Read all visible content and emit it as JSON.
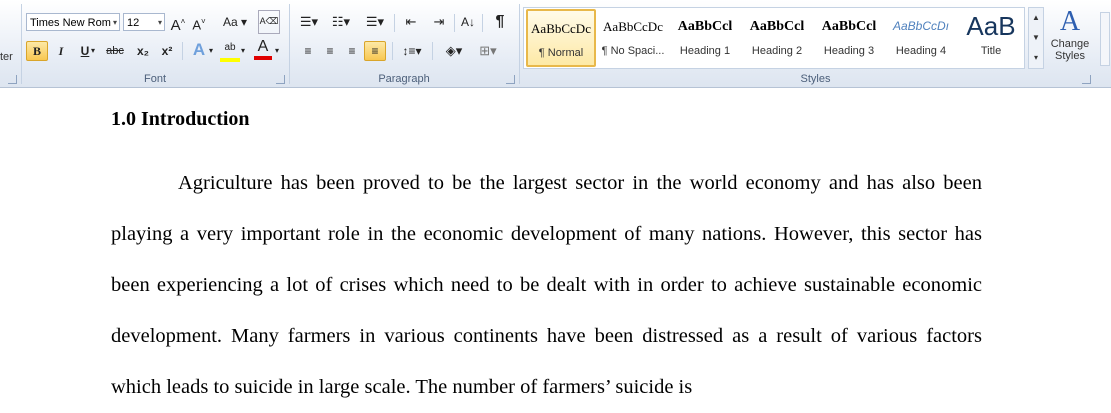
{
  "ribbon": {
    "clipboard_partial_label": "ter",
    "font_group": {
      "label": "Font",
      "font_name": "Times New Rom",
      "font_size": "12",
      "grow_label": "A",
      "shrink_label": "A",
      "case_label": "Aa",
      "bold": "B",
      "italic": "I",
      "underline": "U",
      "strike": "abc",
      "subscript": "x₂",
      "superscript": "x²",
      "effects": "A",
      "highlight": "ab",
      "font_color": "A"
    },
    "paragraph_group": {
      "label": "Paragraph",
      "show_marks": "¶"
    },
    "styles_group": {
      "label": "Styles",
      "items": [
        {
          "sample": "AaBbCcDc",
          "name": "¶ Normal"
        },
        {
          "sample": "AaBbCcDc",
          "name": "¶ No Spaci..."
        },
        {
          "sample": "AaBbCcl",
          "name": "Heading 1"
        },
        {
          "sample": "AaBbCcl",
          "name": "Heading 2"
        },
        {
          "sample": "AaBbCcl",
          "name": "Heading 3"
        },
        {
          "sample": "AaBbCcDı",
          "name": "Heading 4"
        },
        {
          "sample": "AaB",
          "name": "Title"
        }
      ],
      "change_styles_label": "Change Styles",
      "change_styles_glyph": "A"
    }
  },
  "document": {
    "heading": "1.0 Introduction",
    "paragraph": "Agriculture has been proved to be the largest sector in the world economy and has also been playing a very important role in the economic development of many nations. However, this sector has been experiencing a lot of crises which need to be dealt with in order to achieve sustainable economic development. Many farmers in various continents have been distressed as a result of various factors which leads to suicide in large scale. The number of farmers’ suicide is"
  },
  "colors": {
    "accent_selected": "#f8c752",
    "heading4_blue": "#4f81bd",
    "title_blue": "#17365d"
  }
}
